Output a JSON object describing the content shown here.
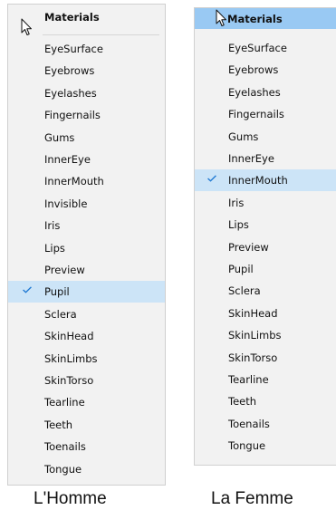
{
  "left_menu": {
    "title": "Materials",
    "items": [
      {
        "label": "EyeSurface",
        "checked": false
      },
      {
        "label": "Eyebrows",
        "checked": false
      },
      {
        "label": "Eyelashes",
        "checked": false
      },
      {
        "label": "Fingernails",
        "checked": false
      },
      {
        "label": "Gums",
        "checked": false
      },
      {
        "label": "InnerEye",
        "checked": false
      },
      {
        "label": "InnerMouth",
        "checked": false
      },
      {
        "label": "Invisible",
        "checked": false
      },
      {
        "label": "Iris",
        "checked": false
      },
      {
        "label": "Lips",
        "checked": false
      },
      {
        "label": "Preview",
        "checked": false
      },
      {
        "label": "Pupil",
        "checked": true
      },
      {
        "label": "Sclera",
        "checked": false
      },
      {
        "label": "SkinHead",
        "checked": false
      },
      {
        "label": "SkinLimbs",
        "checked": false
      },
      {
        "label": "SkinTorso",
        "checked": false
      },
      {
        "label": "Tearline",
        "checked": false
      },
      {
        "label": "Teeth",
        "checked": false
      },
      {
        "label": "Toenails",
        "checked": false
      },
      {
        "label": "Tongue",
        "checked": false
      }
    ],
    "caption": "L'Homme"
  },
  "right_menu": {
    "title": "Materials",
    "items": [
      {
        "label": "EyeSurface",
        "checked": false
      },
      {
        "label": "Eyebrows",
        "checked": false
      },
      {
        "label": "Eyelashes",
        "checked": false
      },
      {
        "label": "Fingernails",
        "checked": false
      },
      {
        "label": "Gums",
        "checked": false
      },
      {
        "label": "InnerEye",
        "checked": false
      },
      {
        "label": "InnerMouth",
        "checked": true
      },
      {
        "label": "Iris",
        "checked": false
      },
      {
        "label": "Lips",
        "checked": false
      },
      {
        "label": "Preview",
        "checked": false
      },
      {
        "label": "Pupil",
        "checked": false
      },
      {
        "label": "Sclera",
        "checked": false
      },
      {
        "label": "SkinHead",
        "checked": false
      },
      {
        "label": "SkinLimbs",
        "checked": false
      },
      {
        "label": "SkinTorso",
        "checked": false
      },
      {
        "label": "Tearline",
        "checked": false
      },
      {
        "label": "Teeth",
        "checked": false
      },
      {
        "label": "Toenails",
        "checked": false
      },
      {
        "label": "Tongue",
        "checked": false
      }
    ],
    "caption": "La Femme"
  },
  "colors": {
    "menu_bg": "#f2f2f2",
    "highlight": "#99c9f3",
    "checked_bg": "#cce4f7",
    "check_mark": "#1e78d2"
  },
  "icons": {
    "cursor": "mouse-pointer-icon",
    "check": "checkmark-icon"
  }
}
